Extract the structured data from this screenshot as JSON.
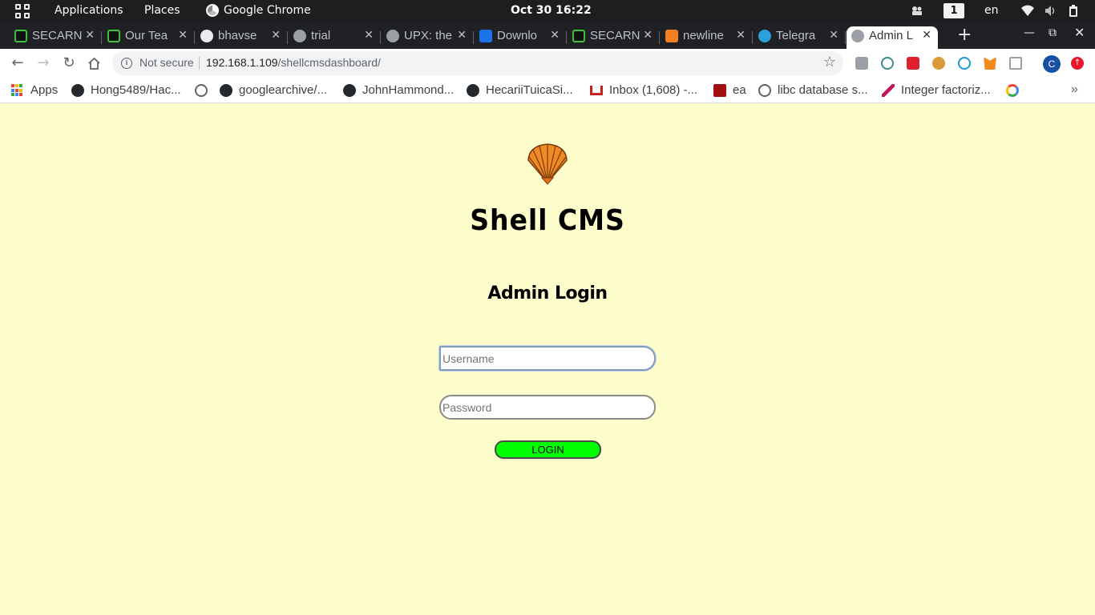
{
  "system_bar": {
    "applications": "Applications",
    "places": "Places",
    "active_app": "Google Chrome",
    "clock": "Oct 30  16:22",
    "workspace": "1",
    "language": "en"
  },
  "tabs": [
    {
      "title": "SECARN",
      "favicon": "secarmy-icon",
      "active": false
    },
    {
      "title": "Our Tea",
      "favicon": "secarmy-icon",
      "active": false
    },
    {
      "title": "bhavse",
      "favicon": "github-icon",
      "active": false
    },
    {
      "title": "trial",
      "favicon": "globe-icon",
      "active": false
    },
    {
      "title": "UPX: the",
      "favicon": "globe-icon",
      "active": false
    },
    {
      "title": "Downlo",
      "favicon": "bracket-icon",
      "active": false
    },
    {
      "title": "SECARN",
      "favicon": "secarmy-icon",
      "active": false
    },
    {
      "title": "newline",
      "favicon": "stackoverflow-icon",
      "active": false
    },
    {
      "title": "Telegra",
      "favicon": "telegram-icon",
      "active": false
    },
    {
      "title": "Admin L",
      "favicon": "globe-icon",
      "active": true
    }
  ],
  "toolbar": {
    "security_label": "Not secure",
    "url_host": "192.168.1.109",
    "url_path": "/shellcmsdashboard/",
    "avatar_letter": "C"
  },
  "bookmarks": [
    {
      "label": "Apps",
      "icon": "apps-icon"
    },
    {
      "label": "Hong5489/Hac...",
      "icon": "github-icon"
    },
    {
      "label": "",
      "icon": "globe-icon"
    },
    {
      "label": "googlearchive/...",
      "icon": "github-icon"
    },
    {
      "label": "JohnHammond...",
      "icon": "github-icon"
    },
    {
      "label": "HecariiTuicaSi...",
      "icon": "github-icon"
    },
    {
      "label": "Inbox (1,608) -...",
      "icon": "gmail-icon"
    },
    {
      "label": "ea",
      "icon": "r-icon"
    },
    {
      "label": "libc database s...",
      "icon": "globe-icon"
    },
    {
      "label": "Integer factoriz...",
      "icon": "alpertron-icon"
    },
    {
      "label": "",
      "icon": "google-icon"
    }
  ],
  "page": {
    "site_title": "Shell CMS",
    "subtitle": "Admin Login",
    "username_placeholder": "Username",
    "password_placeholder": "Password",
    "login_label": "LOGIN",
    "colors": {
      "background": "#fdfdcb",
      "login_button": "#00ff00",
      "logo": "#f08a24"
    }
  }
}
